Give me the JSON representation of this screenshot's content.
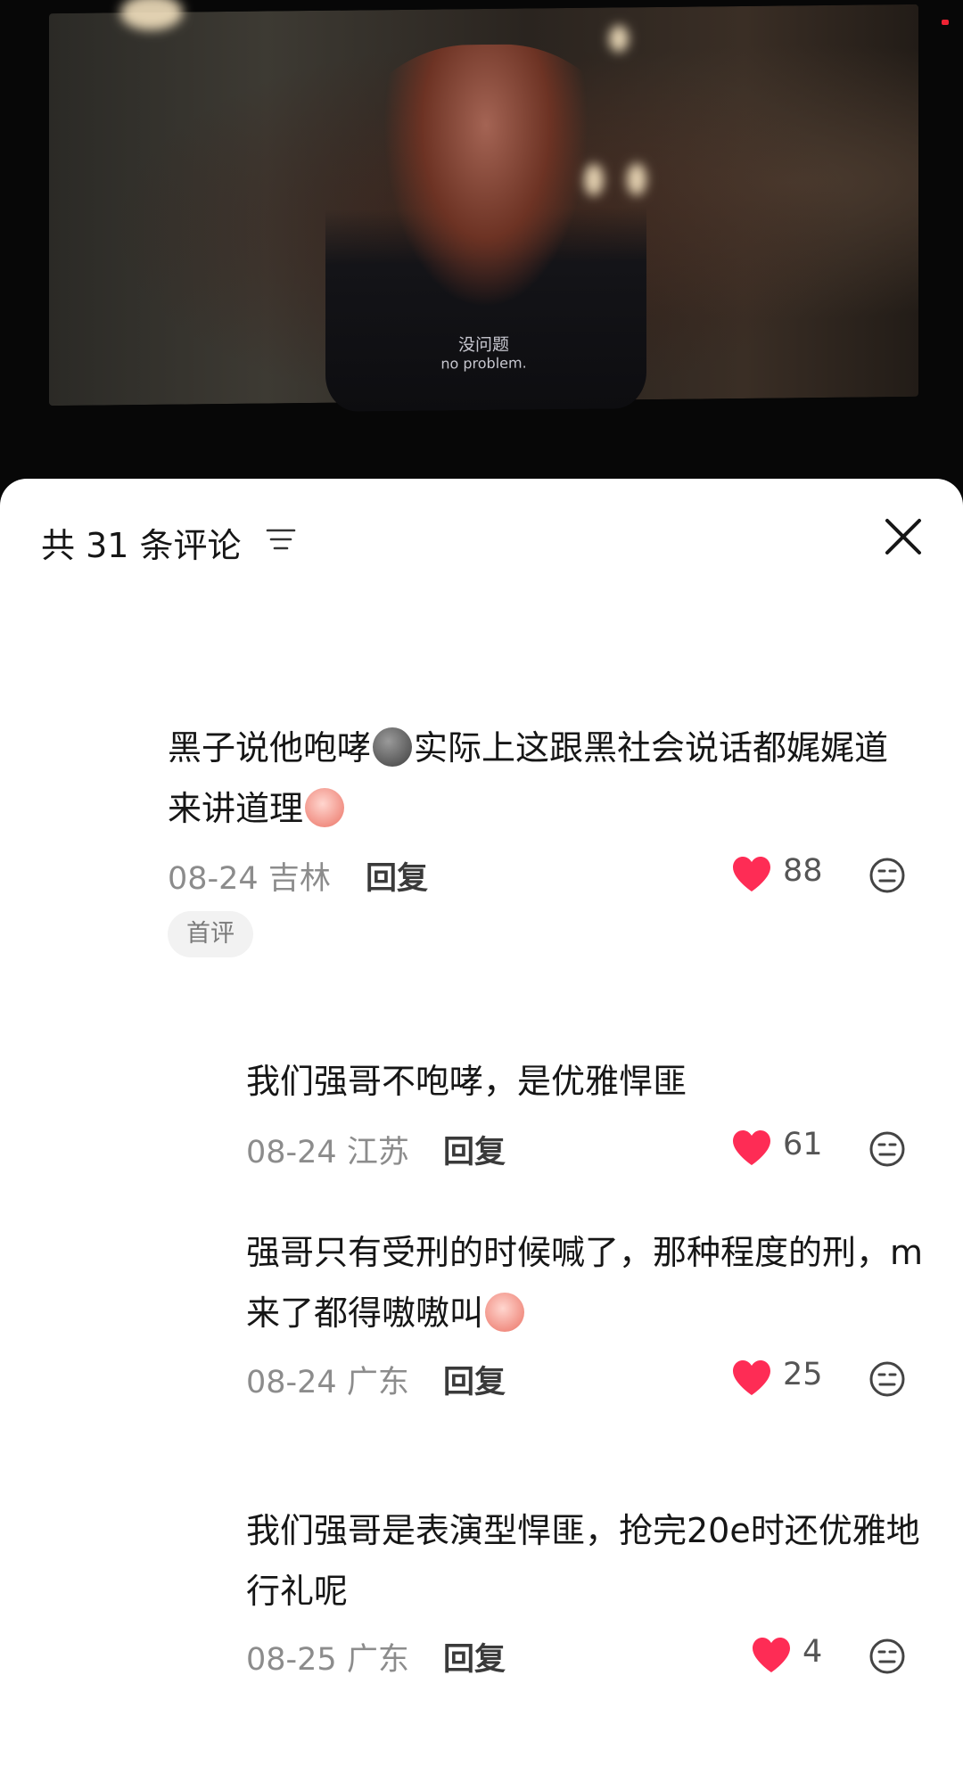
{
  "video": {
    "subtitle_cn": "没问题",
    "subtitle_en": "no problem."
  },
  "sheet": {
    "title": "共 31 条评论"
  },
  "comments": [
    {
      "text_a": "黑子说他咆哮",
      "emoji_a": "rock-face-emoji",
      "text_b": "实际上这跟黑社会说话都娓娓道来讲道理",
      "emoji_b": "crying-face-emoji",
      "date": "08-24",
      "location": "吉林",
      "reply_label": "回复",
      "likes": "88",
      "badge": "首评"
    },
    {
      "text": "我们强哥不咆哮，是优雅悍匪",
      "date": "08-24",
      "location": "江苏",
      "reply_label": "回复",
      "likes": "61"
    },
    {
      "text": "强哥只有受刑的时候喊了，那种程度的刑，m来了都得嗷嗷叫",
      "emoji": "crying-face-emoji",
      "date": "08-24",
      "location": "广东",
      "reply_label": "回复",
      "likes": "25"
    },
    {
      "text": "我们强哥是表演型悍匪，抢完20e时还优雅地行礼呢",
      "date": "08-25",
      "location": "广东",
      "reply_label": "回复",
      "likes": "4"
    }
  ],
  "colors": {
    "like": "#fe2c55",
    "text": "#161616",
    "meta": "#8c8c8c"
  }
}
